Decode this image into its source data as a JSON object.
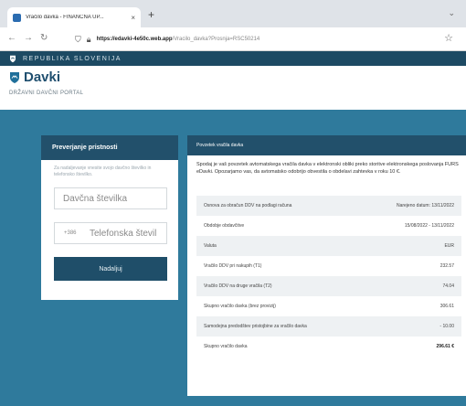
{
  "browser": {
    "tab_title": "Vračilo davka - FINANČNA UP...",
    "tab_close": "×",
    "new_tab": "+",
    "url_host": "https://edavki-4e50c.web.app",
    "url_path": "/Vracilo_davka?Prosnja=RSC50214",
    "icons": [
      "back-icon",
      "forward-icon",
      "reload-icon",
      "shield-icon",
      "lock-icon",
      "star-icon"
    ]
  },
  "republic_bar": {
    "text": "REPUBLIKA SLOVENIJA"
  },
  "site": {
    "logo": "Davki",
    "subtitle": "DRŽAVNI DAVČNI PORTAL"
  },
  "auth": {
    "title": "Preverjanje pristnosti",
    "help": "Za nadaljevanje vnesite svojo davčno številko in telefonsko številko.",
    "tax_placeholder": "Davčna številka",
    "phone_prefix": "+386",
    "phone_placeholder": "Telefonska števil",
    "submit": "Nadaljuj"
  },
  "refund": {
    "title": "Povzetek vračila davka",
    "description": "Spodaj je vaš povzetek avtomatskega vračila davka v elektronski obliki preko storitve elektronskega poslovanja FURS eDavki. Opozarjamo vas, da avtomatsko odobrijo obvestila o obdelavi zahtevka v roku 10 €.",
    "rows": [
      {
        "label": "Osnova za obračun DDV na podlagi računa",
        "value": "Narejeno datum: 13/11/2022"
      },
      {
        "label": "Obdobje obdavčitve",
        "value": "15/08/2022 - 13/11/2022"
      },
      {
        "label": "Valuta",
        "value": "EUR"
      },
      {
        "label": "Vračilo DDV pri nakupih (T1)",
        "value": "232.57"
      },
      {
        "label": "Vračilo DDV na druge vračila (T2)",
        "value": "74.04"
      },
      {
        "label": "Skupno vračilo davka (brez provizij)",
        "value": "306.61"
      },
      {
        "label": "Samodejna predodštev pristojbine za vračilo davka",
        "value": "- 10.00"
      },
      {
        "label": "Skupno vračilo davka",
        "value": "296.61 €"
      }
    ]
  },
  "colors": {
    "dark_navy": "#22506b",
    "teal": "#2f7a9c",
    "alt_row": "#eef1f3"
  }
}
